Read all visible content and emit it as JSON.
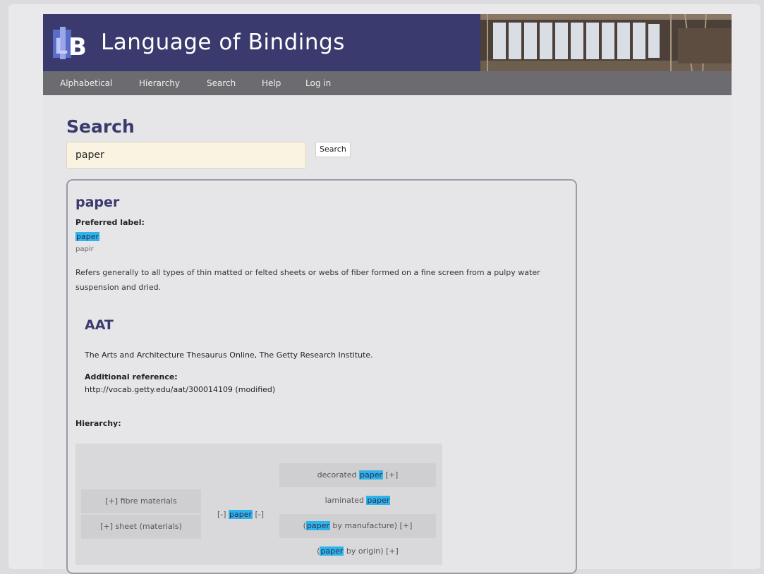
{
  "site": {
    "title": "Language of Bindings",
    "logo_text": "LB"
  },
  "nav": {
    "items": [
      "Alphabetical",
      "Hierarchy",
      "Search",
      "Help",
      "Log in"
    ]
  },
  "search": {
    "heading": "Search",
    "query": "paper",
    "button_label": "Search"
  },
  "result": {
    "term": "paper",
    "preferred_label_heading": "Preferred label:",
    "preferred_label": "paper",
    "alt_label": "papir",
    "definition": "Refers generally to all types of thin matted or felted sheets or webs of fiber formed on a fine screen from a pulpy water suspension and dried.",
    "source": {
      "title": "AAT",
      "description": "The Arts and Architecture Thesaurus Online, The Getty Research Institute.",
      "additional_reference_heading": "Additional reference:",
      "additional_reference": "http://vocab.getty.edu/aat/300014109 (modified)"
    },
    "hierarchy": {
      "heading": "Hierarchy:",
      "parents": [
        {
          "prefix": "[+]",
          "label": "fibre materials"
        },
        {
          "prefix": "[+]",
          "label": "sheet (materials)"
        }
      ],
      "current": {
        "prefix": "[-]",
        "label": "paper",
        "suffix": "[-]"
      },
      "children": [
        {
          "before": "decorated ",
          "hl": "paper",
          "after": " [+]"
        },
        {
          "before": "laminated ",
          "hl": "paper",
          "after": ""
        },
        {
          "before": "(",
          "hl": "paper",
          "after": " by manufacture) [+]"
        },
        {
          "before": "(",
          "hl": "paper",
          "after": " by origin) [+]"
        }
      ]
    }
  },
  "colors": {
    "header_bg": "#3a3a6e",
    "nav_bg": "#6c6c70",
    "highlight": "#2fb4e8",
    "heading": "#3a3a6e"
  }
}
